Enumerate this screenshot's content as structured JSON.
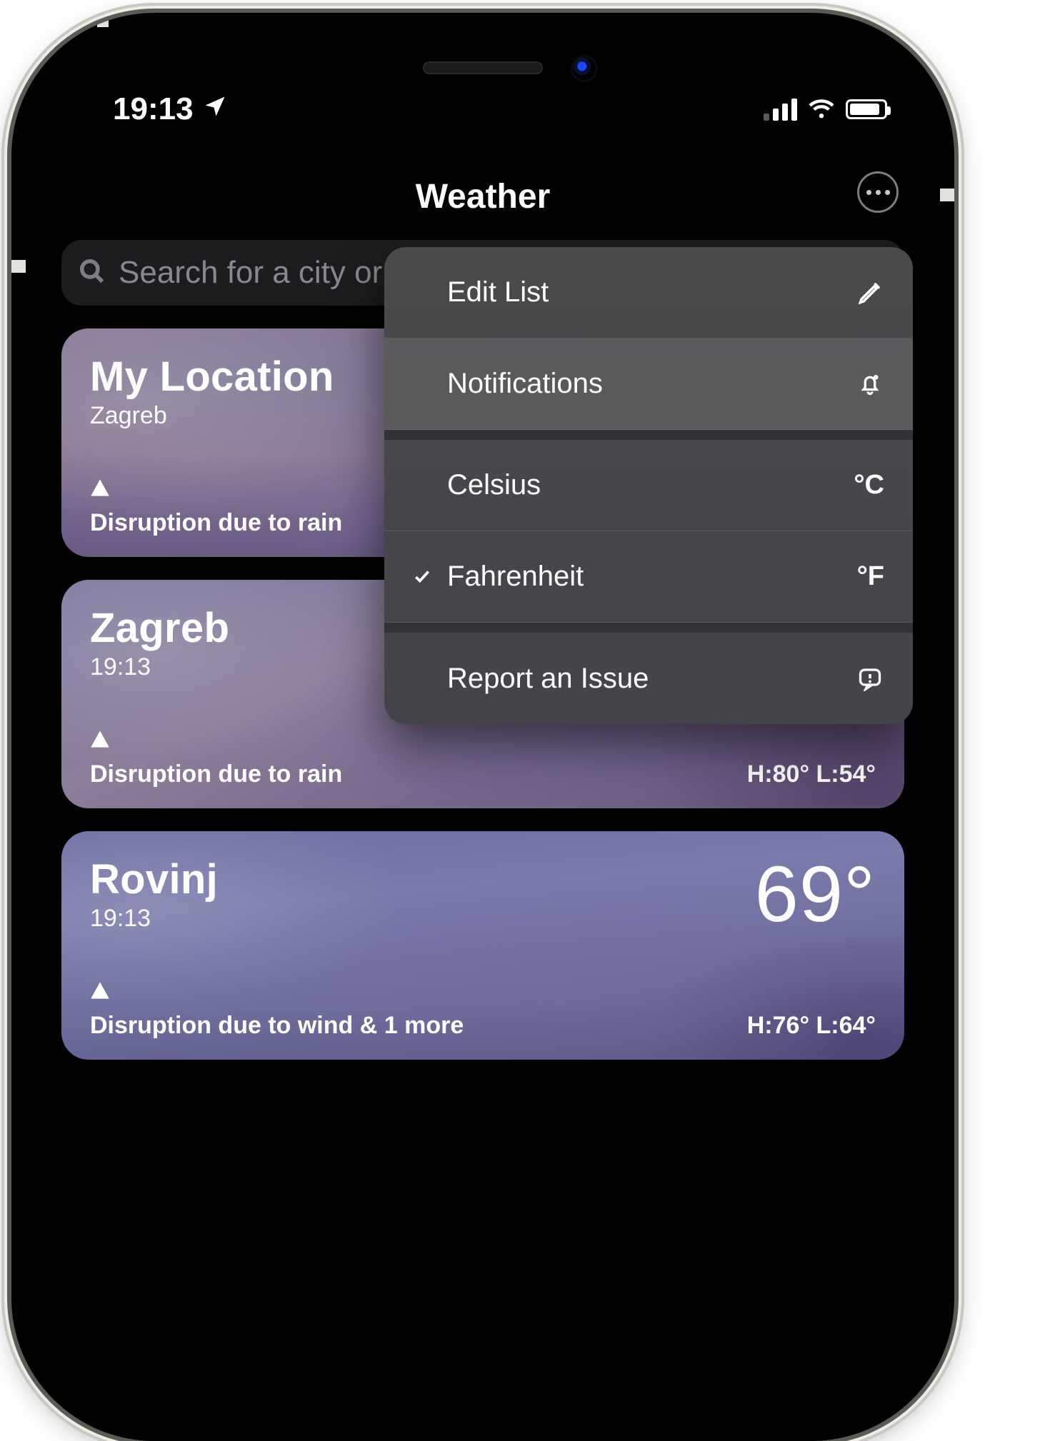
{
  "status_bar": {
    "time": "19:13"
  },
  "header": {
    "title": "Weather"
  },
  "search": {
    "placeholder": "Search for a city or airport"
  },
  "cards": [
    {
      "name": "My Location",
      "subtitle": "Zagreb",
      "temp": "",
      "alert": "Disruption due to rain",
      "hl": ""
    },
    {
      "name": "Zagreb",
      "subtitle": "19:13",
      "temp": "",
      "alert": "Disruption due to rain",
      "hl": "H:80°  L:54°"
    },
    {
      "name": "Rovinj",
      "subtitle": "19:13",
      "temp": "69°",
      "alert": "Disruption due to wind & 1 more",
      "hl": "H:76°  L:64°"
    }
  ],
  "menu": {
    "edit": "Edit List",
    "notifications": "Notifications",
    "celsius": "Celsius",
    "celsius_sym": "°C",
    "fahrenheit": "Fahrenheit",
    "fahrenheit_sym": "°F",
    "report": "Report an Issue"
  }
}
